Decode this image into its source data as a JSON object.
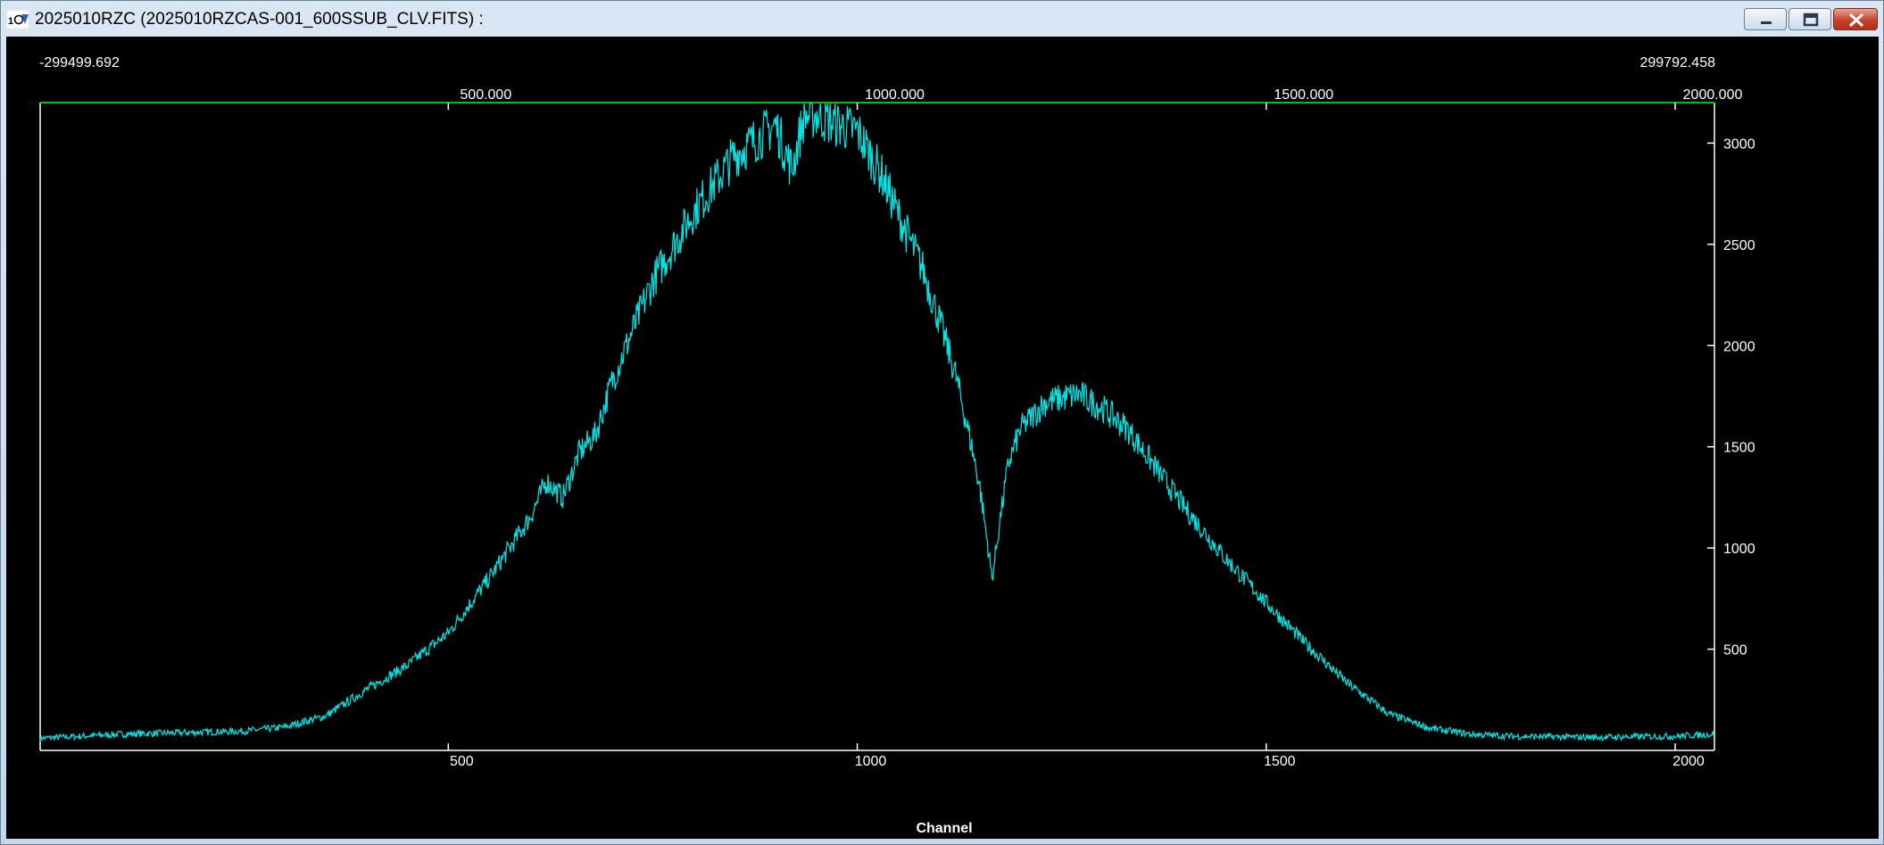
{
  "window": {
    "title": "2025010RZC (2025010RZCAS-001_600SSUB_CLV.FITS) :",
    "app_icon": "tablo-app-icon",
    "buttons": {
      "minimize": "minimize-icon",
      "maximize": "maximize-icon",
      "close": "close-icon"
    }
  },
  "colors": {
    "background": "#000000",
    "trace": "#00e5e5",
    "frame": "#ffffff",
    "top_axis": "#00c000",
    "text": "#ffffff"
  },
  "plot": {
    "top_left_value": "-299499.692",
    "top_right_value": "299792.458"
  },
  "chart_data": {
    "type": "line",
    "title": "",
    "xlabel": "Channel",
    "ylabel": "",
    "xlim": [
      1,
      2048
    ],
    "ylim": [
      0,
      3200
    ],
    "x_ticks": [
      500,
      1000,
      1500,
      2000
    ],
    "x_tick_labels": [
      "500",
      "1000",
      "1500",
      "2000"
    ],
    "top_ticks": [
      500,
      1000,
      1500,
      2000
    ],
    "top_tick_labels": [
      "500.000",
      "1000.000",
      "1500.000",
      "2000.000"
    ],
    "y_ticks": [
      500,
      1000,
      1500,
      2000,
      2500,
      3000
    ],
    "y_tick_labels": [
      "500",
      "1000",
      "1500",
      "2000",
      "2500",
      "3000"
    ],
    "grid": false,
    "series": [
      {
        "x": [
          1,
          100,
          200,
          250,
          300,
          350,
          400,
          450,
          500,
          550,
          600,
          620,
          640,
          660,
          680,
          700,
          750,
          800,
          850,
          900,
          920,
          935,
          950,
          970,
          1000,
          1030,
          1050,
          1080,
          1100,
          1120,
          1140,
          1150,
          1165,
          1175,
          1185,
          1200,
          1230,
          1270,
          1300,
          1330,
          1350,
          1400,
          1450,
          1500,
          1550,
          1600,
          1650,
          1700,
          1750,
          1800,
          1900,
          2000,
          2048
        ],
        "y": [
          60,
          80,
          90,
          95,
          115,
          170,
          300,
          420,
          580,
          850,
          1150,
          1330,
          1250,
          1470,
          1560,
          1820,
          2320,
          2660,
          2940,
          3090,
          2870,
          3130,
          3140,
          3100,
          3060,
          2840,
          2650,
          2380,
          2130,
          1860,
          1500,
          1300,
          850,
          1150,
          1420,
          1590,
          1720,
          1760,
          1690,
          1590,
          1480,
          1200,
          950,
          730,
          520,
          330,
          180,
          110,
          80,
          70,
          65,
          70,
          80
        ]
      }
    ]
  }
}
